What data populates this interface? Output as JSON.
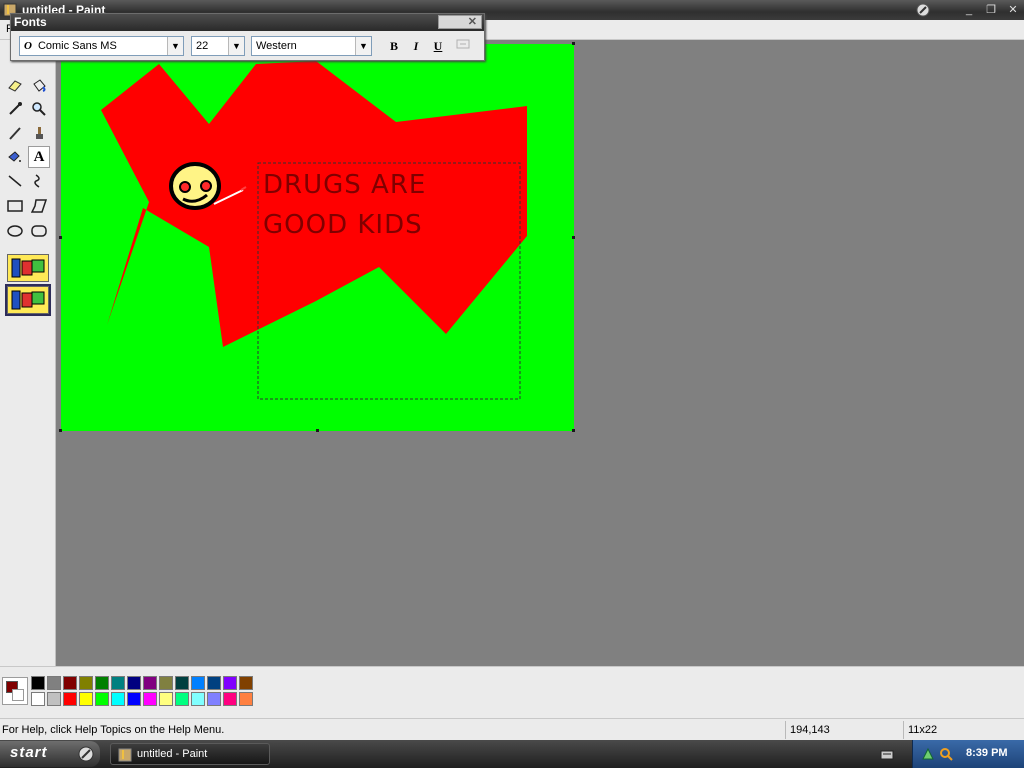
{
  "window": {
    "title": "untitled - Paint",
    "menu_first_letter": "F"
  },
  "fonts_toolbar": {
    "title": "Fonts",
    "font_name": "Comic Sans MS",
    "font_size": "22",
    "script": "Western",
    "bold_label": "B",
    "italic_label": "I",
    "underline_label": "U"
  },
  "canvas": {
    "text_line1": "DRUGS ARE",
    "text_line2": "GOOD KIDS",
    "background_color": "#00ff00",
    "shape_color": "#ff0000",
    "text_color": "#800000"
  },
  "colors": {
    "primary": "#800000",
    "secondary": "#ffffff",
    "palette_row1": [
      "#000000",
      "#808080",
      "#800000",
      "#808000",
      "#008000",
      "#008080",
      "#000080",
      "#800080",
      "#808040",
      "#004040",
      "#0080ff",
      "#004080",
      "#8000ff",
      "#804000"
    ],
    "palette_row2": [
      "#ffffff",
      "#c0c0c0",
      "#ff0000",
      "#ffff00",
      "#00ff00",
      "#00ffff",
      "#0000ff",
      "#ff00ff",
      "#ffff80",
      "#00ff80",
      "#80ffff",
      "#8080ff",
      "#ff0080",
      "#ff8040"
    ]
  },
  "status": {
    "help_text": "For Help, click Help Topics on the Help Menu.",
    "coords": "194,143",
    "size": "11x22"
  },
  "taskbar": {
    "start_label": "start",
    "task_label": "untitled - Paint",
    "clock": "8:39 PM"
  }
}
